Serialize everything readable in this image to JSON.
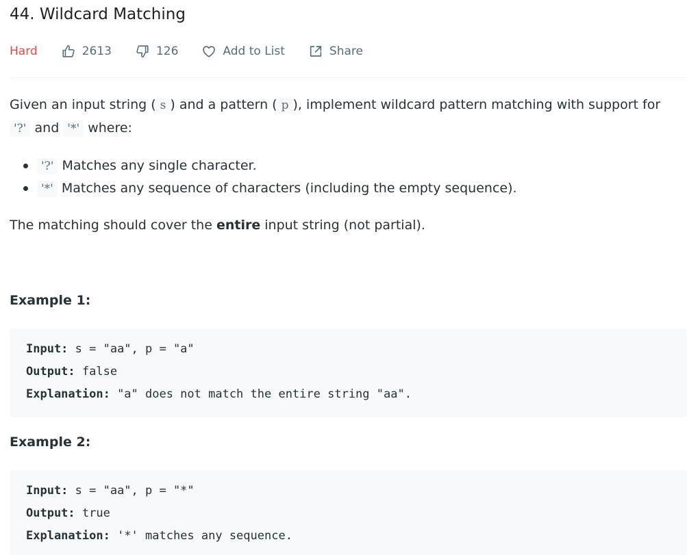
{
  "problem": {
    "title": "44. Wildcard Matching",
    "difficulty": "Hard",
    "likes": "2613",
    "dislikes": "126",
    "add_to_list_label": "Add to List",
    "share_label": "Share"
  },
  "description": {
    "intro_part1": "Given an input string (",
    "intro_code_s": "s",
    "intro_part2": ") and a pattern (",
    "intro_code_p": "p",
    "intro_part3": "), implement wildcard pattern matching with support for",
    "intro_code_q": "'?'",
    "intro_and": " and ",
    "intro_code_star": "'*'",
    "intro_where": " where:",
    "bullets": [
      {
        "code": "'?'",
        "text": " Matches any single character."
      },
      {
        "code": "'*'",
        "text": " Matches any sequence of characters (including the empty sequence)."
      }
    ],
    "coverage_before": "The matching should cover the ",
    "coverage_bold": "entire",
    "coverage_after": " input string (not partial)."
  },
  "examples": [
    {
      "heading": "Example 1:",
      "input_label": "Input:",
      "input_value": " s = \"aa\", p = \"a\"",
      "output_label": "Output:",
      "output_value": " false",
      "explanation_label": "Explanation:",
      "explanation_value": " \"a\" does not match the entire string \"aa\"."
    },
    {
      "heading": "Example 2:",
      "input_label": "Input:",
      "input_value": " s = \"aa\", p = \"*\"",
      "output_label": "Output:",
      "output_value": " true",
      "explanation_label": "Explanation:",
      "explanation_value": " '*' matches any sequence."
    }
  ],
  "colors": {
    "difficulty_hard": "#ef4743",
    "meta_text": "#546e7a",
    "body_text": "#263238",
    "code_bg": "#f7f9fa"
  },
  "icons": {
    "like": "thumbs-up-icon",
    "dislike": "thumbs-down-icon",
    "add_to_list": "heart-icon",
    "share": "share-icon"
  }
}
